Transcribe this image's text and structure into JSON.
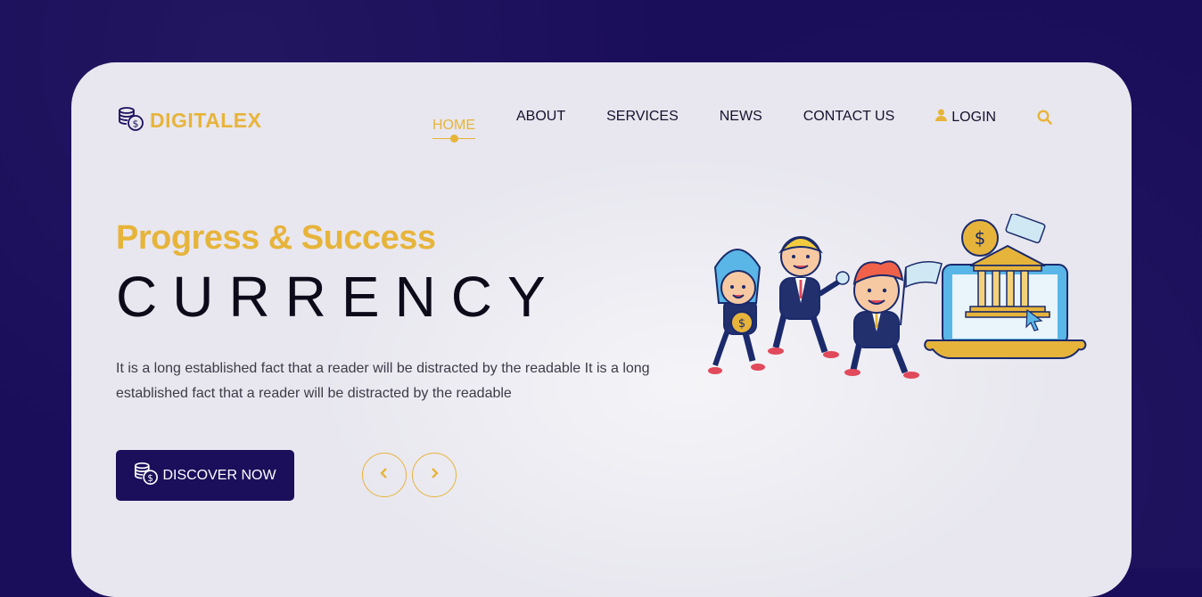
{
  "brand": {
    "name": "DIGITALEX",
    "logo_icon": "coins-icon"
  },
  "nav": {
    "items": [
      {
        "label": "HOME",
        "active": true
      },
      {
        "label": "ABOUT"
      },
      {
        "label": "SERVICES"
      },
      {
        "label": "NEWS"
      },
      {
        "label": "CONTACT US"
      }
    ],
    "login_label": "LOGIN",
    "login_icon": "user-icon",
    "search_icon": "search-icon"
  },
  "hero": {
    "subtitle": "Progress & Success",
    "title": "CURRENCY",
    "description": "It is a long established fact that a reader will be distracted by the readable It is a long established fact that a reader will be distracted by the readable",
    "cta_label": "DISCOVER NOW",
    "cta_icon": "coins-icon",
    "prev_icon": "chevron-left-icon",
    "next_icon": "chevron-right-icon"
  },
  "colors": {
    "accent": "#e7b43b",
    "dark": "#1b0f5c",
    "card_bg": "#e8e7ef",
    "page_bg": "#1a0d5a"
  }
}
